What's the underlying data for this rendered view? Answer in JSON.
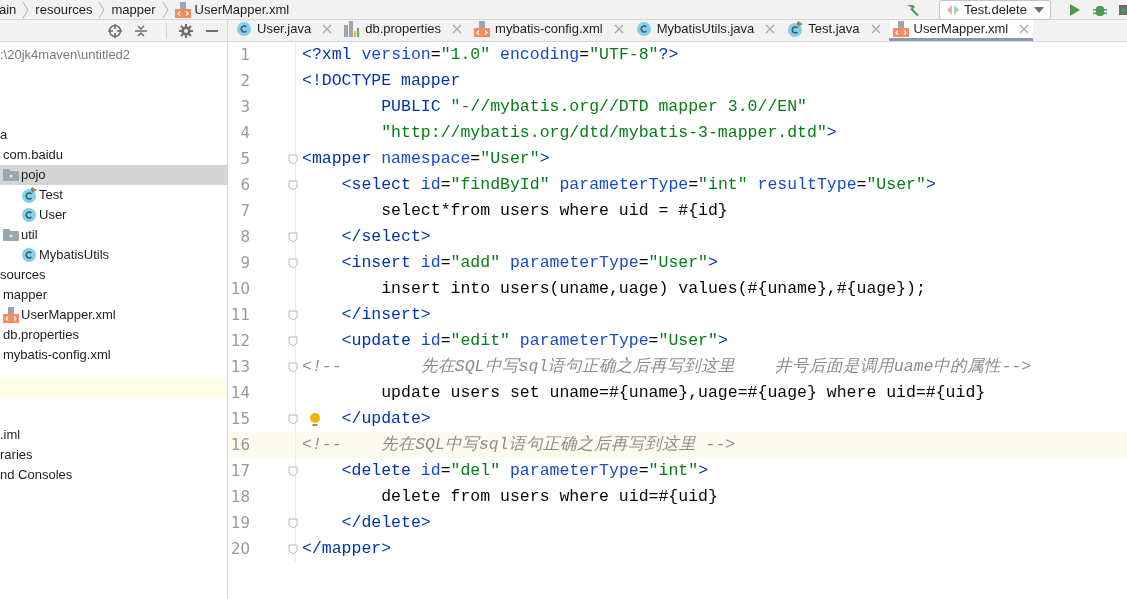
{
  "breadcrumb": [
    {
      "label": "ain"
    },
    {
      "label": "resources"
    },
    {
      "label": "mapper"
    },
    {
      "label": "UserMapper.xml",
      "kind": "xml"
    }
  ],
  "run_config": {
    "label": "Test.delete"
  },
  "project_tree": {
    "root_path": ":\\20jk4maven\\untitled2",
    "items": [
      {
        "label": "a",
        "selected": false,
        "children": [
          {
            "label": "com.baidu",
            "selected": false,
            "children": [
              {
                "label": "pojo",
                "kind": "folder",
                "selected": true,
                "children": [
                  {
                    "label": "Test",
                    "kind": "runnable-class",
                    "selected": false
                  },
                  {
                    "label": "User",
                    "kind": "class",
                    "selected": false
                  }
                ]
              },
              {
                "label": "util",
                "kind": "folder",
                "selected": false,
                "children": [
                  {
                    "label": "MybatisUtils",
                    "kind": "class",
                    "selected": false
                  }
                ]
              }
            ]
          }
        ]
      },
      {
        "label": "sources",
        "selected": false,
        "children": [
          {
            "label": "mapper",
            "selected": false,
            "children": [
              {
                "label": "UserMapper.xml",
                "kind": "xml",
                "selected": false
              }
            ]
          },
          {
            "label": "db.properties",
            "selected": false
          },
          {
            "label": "mybatis-config.xml",
            "selected": false
          }
        ]
      }
    ],
    "bottom_items": [
      {
        "label": ".iml",
        "selected": false
      },
      {
        "label": "raries",
        "selected": false
      },
      {
        "label": "nd Consoles",
        "selected": false
      }
    ]
  },
  "tabs": [
    {
      "label": "User.java",
      "kind": "class",
      "selected": false
    },
    {
      "label": "db.properties",
      "kind": "properties",
      "selected": false
    },
    {
      "label": "mybatis-config.xml",
      "kind": "xml",
      "selected": false
    },
    {
      "label": "MybatisUtils.java",
      "kind": "class",
      "selected": false
    },
    {
      "label": "Test.java",
      "kind": "runnable-class",
      "selected": false
    },
    {
      "label": "UserMapper.xml",
      "kind": "xml",
      "selected": true
    }
  ],
  "editor": {
    "lines": [
      {
        "number": "1",
        "fold": false,
        "current": false,
        "tokens": [
          {
            "kind": "tag",
            "text": "<?xml "
          },
          {
            "kind": "attr",
            "text": "version"
          },
          {
            "kind": "text",
            "text": "="
          },
          {
            "kind": "value",
            "text": "\"1.0\" "
          },
          {
            "kind": "attr",
            "text": "encoding"
          },
          {
            "kind": "text",
            "text": "="
          },
          {
            "kind": "value",
            "text": "\"UTF-8\""
          },
          {
            "kind": "tag",
            "text": "?>"
          }
        ]
      },
      {
        "number": "2",
        "fold": false,
        "current": false,
        "tokens": [
          {
            "kind": "tag",
            "text": "<!DOCTYPE mapper"
          }
        ]
      },
      {
        "number": "3",
        "fold": false,
        "current": false,
        "tokens": [
          {
            "kind": "tag",
            "text": "        PUBLIC "
          },
          {
            "kind": "value",
            "text": "\"-//mybatis.org//DTD mapper 3.0//EN\""
          }
        ]
      },
      {
        "number": "4",
        "fold": false,
        "current": false,
        "tokens": [
          {
            "kind": "value",
            "text": "        \"http://mybatis.org/dtd/mybatis-3-mapper.dtd\""
          },
          {
            "kind": "tag",
            "text": ">"
          }
        ]
      },
      {
        "number": "5",
        "fold": true,
        "current": false,
        "tokens": [
          {
            "kind": "tag",
            "text": "<mapper "
          },
          {
            "kind": "attr",
            "text": "namespace"
          },
          {
            "kind": "text",
            "text": "="
          },
          {
            "kind": "value",
            "text": "\"User\""
          },
          {
            "kind": "tag",
            "text": ">"
          }
        ]
      },
      {
        "number": "6",
        "fold": true,
        "current": false,
        "tokens": [
          {
            "kind": "tag",
            "text": "    <select "
          },
          {
            "kind": "attr",
            "text": "id"
          },
          {
            "kind": "text",
            "text": "="
          },
          {
            "kind": "value",
            "text": "\"findById\" "
          },
          {
            "kind": "attr",
            "text": "parameterType"
          },
          {
            "kind": "text",
            "text": "="
          },
          {
            "kind": "value",
            "text": "\"int\" "
          },
          {
            "kind": "attr",
            "text": "resultType"
          },
          {
            "kind": "text",
            "text": "="
          },
          {
            "kind": "value",
            "text": "\"User\""
          },
          {
            "kind": "tag",
            "text": ">"
          }
        ]
      },
      {
        "number": "7",
        "fold": false,
        "current": false,
        "tokens": [
          {
            "kind": "text",
            "text": "        select*from users where uid = #{id}"
          }
        ]
      },
      {
        "number": "8",
        "fold": true,
        "current": false,
        "tokens": [
          {
            "kind": "tag",
            "text": "    </select>"
          }
        ]
      },
      {
        "number": "9",
        "fold": true,
        "current": false,
        "tokens": [
          {
            "kind": "tag",
            "text": "    <insert "
          },
          {
            "kind": "attr",
            "text": "id"
          },
          {
            "kind": "text",
            "text": "="
          },
          {
            "kind": "value",
            "text": "\"add\" "
          },
          {
            "kind": "attr",
            "text": "parameterType"
          },
          {
            "kind": "text",
            "text": "="
          },
          {
            "kind": "value",
            "text": "\"User\""
          },
          {
            "kind": "tag",
            "text": ">"
          }
        ]
      },
      {
        "number": "10",
        "fold": false,
        "current": false,
        "tokens": [
          {
            "kind": "text",
            "text": "        insert into users(uname,uage) values(#{uname},#{uage});"
          }
        ]
      },
      {
        "number": "11",
        "fold": true,
        "current": false,
        "tokens": [
          {
            "kind": "tag",
            "text": "    </insert>"
          }
        ]
      },
      {
        "number": "12",
        "fold": true,
        "current": false,
        "tokens": [
          {
            "kind": "tag",
            "text": "    <update "
          },
          {
            "kind": "attr",
            "text": "id"
          },
          {
            "kind": "text",
            "text": "="
          },
          {
            "kind": "value",
            "text": "\"edit\" "
          },
          {
            "kind": "attr",
            "text": "parameterType"
          },
          {
            "kind": "text",
            "text": "="
          },
          {
            "kind": "value",
            "text": "\"User\""
          },
          {
            "kind": "tag",
            "text": ">"
          }
        ]
      },
      {
        "number": "13",
        "fold": true,
        "current": false,
        "tokens": [
          {
            "kind": "comment",
            "text": "<!--        先在SQL中写sql语句正确之后再写到这里    井号后面是调用uame中的属性-->"
          }
        ]
      },
      {
        "number": "14",
        "fold": false,
        "current": false,
        "tokens": [
          {
            "kind": "text",
            "text": "        update users set uname=#{uname},uage=#{uage} where uid=#{uid}"
          }
        ]
      },
      {
        "number": "15",
        "fold": true,
        "current": false,
        "bulb": true,
        "tokens": [
          {
            "kind": "tag",
            "text": "    </update>"
          }
        ]
      },
      {
        "number": "16",
        "fold": false,
        "current": true,
        "tokens": [
          {
            "kind": "comment",
            "text": "<!--    先在SQL中写sql语句正确之后再写到这里 -->"
          }
        ]
      },
      {
        "number": "17",
        "fold": true,
        "current": false,
        "tokens": [
          {
            "kind": "tag",
            "text": "    <delete "
          },
          {
            "kind": "attr",
            "text": "id"
          },
          {
            "kind": "text",
            "text": "="
          },
          {
            "kind": "value",
            "text": "\"del\" "
          },
          {
            "kind": "attr",
            "text": "parameterType"
          },
          {
            "kind": "text",
            "text": "="
          },
          {
            "kind": "value",
            "text": "\"int\""
          },
          {
            "kind": "tag",
            "text": ">"
          }
        ]
      },
      {
        "number": "18",
        "fold": false,
        "current": false,
        "tokens": [
          {
            "kind": "text",
            "text": "        delete from users where uid=#{uid}"
          }
        ]
      },
      {
        "number": "19",
        "fold": true,
        "current": false,
        "tokens": [
          {
            "kind": "tag",
            "text": "    </delete>"
          }
        ]
      },
      {
        "number": "20",
        "fold": true,
        "current": false,
        "tokens": [
          {
            "kind": "tag",
            "text": "</mapper>"
          }
        ]
      }
    ]
  }
}
